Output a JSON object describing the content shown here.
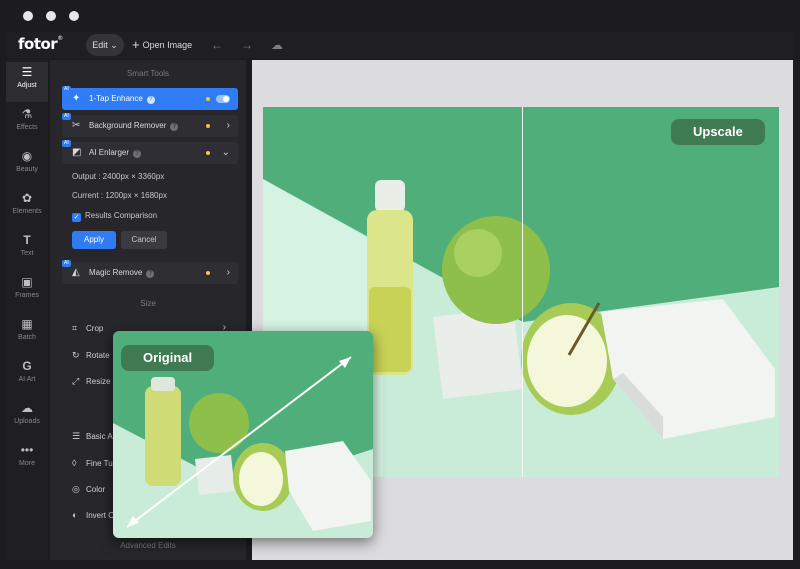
{
  "window": {
    "dots": [
      "close",
      "minimize",
      "zoom"
    ]
  },
  "topbar": {
    "logo": "fotor",
    "logo_mark": "®",
    "edit_label": "Edit",
    "open_image_label": "Open Image",
    "icons": [
      "undo-icon",
      "redo-icon",
      "cloud-icon"
    ]
  },
  "nav": {
    "items": [
      {
        "label": "Adjust",
        "icon": "sliders-icon",
        "active": true
      },
      {
        "label": "Effects",
        "icon": "flask-icon",
        "active": false
      },
      {
        "label": "Beauty",
        "icon": "eye-icon",
        "active": false
      },
      {
        "label": "Elements",
        "icon": "shapes-icon",
        "active": false
      },
      {
        "label": "Text",
        "icon": "text-icon",
        "active": false
      },
      {
        "label": "Frames",
        "icon": "frame-icon",
        "active": false
      },
      {
        "label": "Batch",
        "icon": "batch-icon",
        "active": false
      },
      {
        "label": "AI Art",
        "icon": "ai-art-icon",
        "active": false
      },
      {
        "label": "Uploads",
        "icon": "upload-icon",
        "active": false
      },
      {
        "label": "More",
        "icon": "more-icon",
        "active": false
      }
    ]
  },
  "panel": {
    "smart_tools_title": "Smart Tools",
    "ai_badge": "AI",
    "one_tap": {
      "label": "1-Tap Enhance",
      "active": true,
      "toggle": true
    },
    "bg_remover": {
      "label": "Background Remover"
    },
    "ai_enlarger": {
      "label": "AI Enlarger",
      "output": "Output : 2400px × 3360px",
      "current": "Current : 1200px × 1680px",
      "checkbox_label": "Results Comparison",
      "checkbox_checked": true,
      "apply_label": "Apply",
      "cancel_label": "Cancel"
    },
    "magic_remove": {
      "label": "Magic Remove"
    },
    "size_title": "Size",
    "size_items": [
      "Crop",
      "Rotate",
      "Resize"
    ],
    "adjust_items": [
      "Basic A",
      "Fine Tu",
      "Color",
      "Invert C"
    ],
    "advanced_title": "Advanced Edits"
  },
  "canvas": {
    "upscale_label": "Upscale",
    "original_label": "Original"
  },
  "colors": {
    "accent": "#2f7cf6",
    "tag_green": "#3f7a52",
    "dot_yellow": "#f5c542"
  }
}
